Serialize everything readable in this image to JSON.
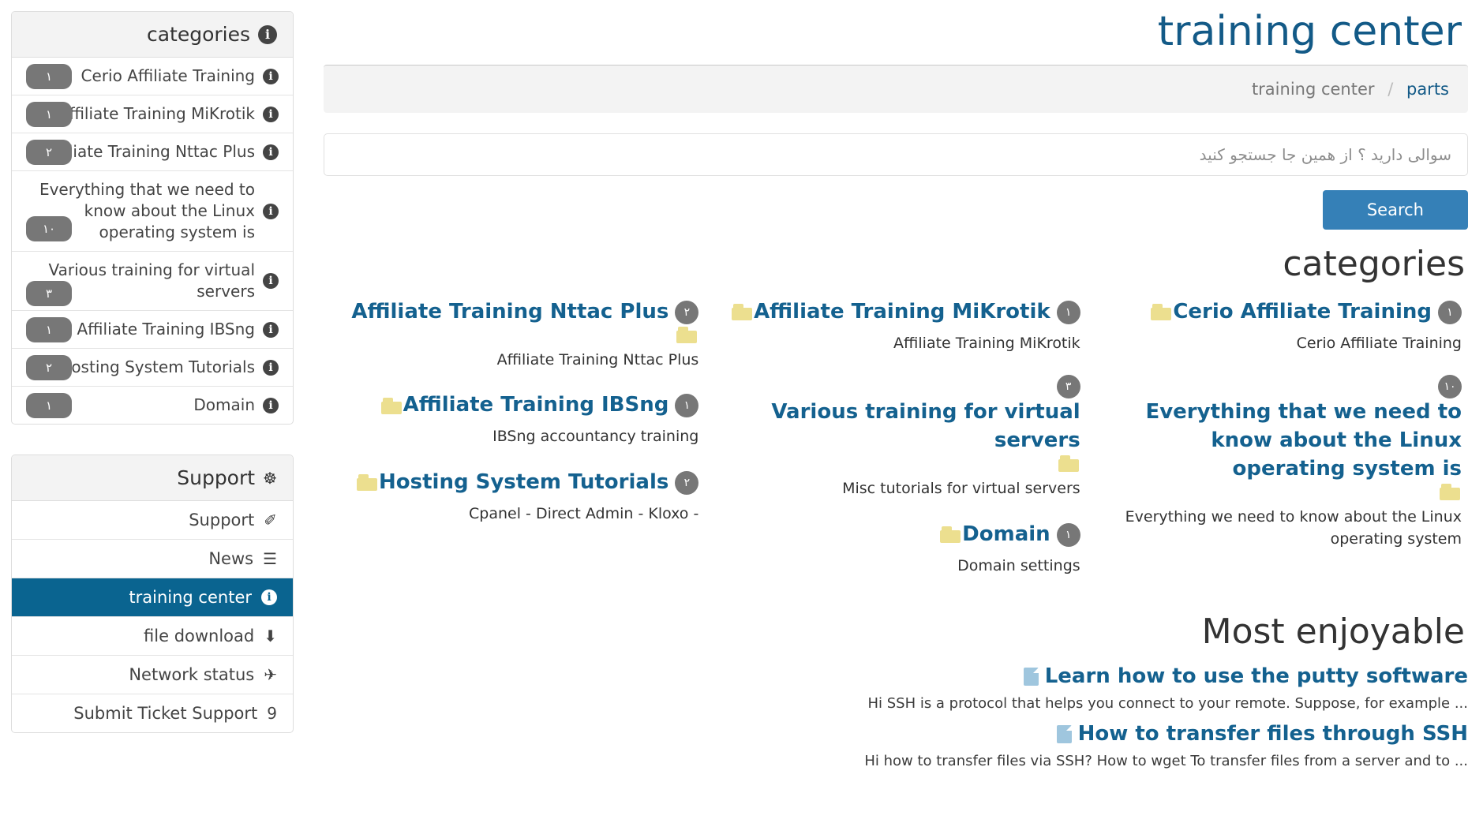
{
  "sidebar": {
    "categories_panel": {
      "title": "categories",
      "title_icon": "info-icon",
      "items": [
        {
          "label": "Cerio Affiliate Training",
          "count": "١",
          "tall": false
        },
        {
          "label": "Affiliate Training MiKrotik",
          "count": "١",
          "tall": false
        },
        {
          "label": "Affiliate Training Nttac Plus",
          "count": "٢",
          "tall": false
        },
        {
          "label": "Everything that we need to know about the Linux operating system is",
          "count": "١٠",
          "tall": true
        },
        {
          "label": "Various training for virtual servers",
          "count": "٣",
          "tall": true
        },
        {
          "label": "Affiliate Training IBSng",
          "count": "١",
          "tall": false
        },
        {
          "label": "Hosting System Tutorials",
          "count": "٢",
          "tall": false
        },
        {
          "label": "Domain",
          "count": "١",
          "tall": false
        }
      ]
    },
    "support_panel": {
      "title": "Support",
      "title_icon": "lifebuoy-icon",
      "items": [
        {
          "label": "Support",
          "icon": "ticket-icon",
          "glyph": "✐",
          "active": false
        },
        {
          "label": "News",
          "icon": "list-icon",
          "glyph": "☰",
          "active": false
        },
        {
          "label": "training center",
          "icon": "info-icon",
          "glyph": "",
          "active": true
        },
        {
          "label": "file download",
          "icon": "download-icon",
          "glyph": "⬇",
          "active": false
        },
        {
          "label": "Network status",
          "icon": "rocket-icon",
          "glyph": "✈",
          "active": false
        },
        {
          "label": "Submit Ticket Support",
          "icon": "comment-icon",
          "glyph": "὞9",
          "active": false
        }
      ]
    }
  },
  "header": {
    "site_title": "training center",
    "breadcrumb": {
      "root": "training center",
      "separator": "/",
      "current": "parts"
    }
  },
  "search": {
    "placeholder": "سوالی دارید ؟ از همین جا جستجو کنید",
    "value": "",
    "button_label": "Search"
  },
  "categories_section": {
    "title": "categories",
    "columns": [
      {
        "items": [
          {
            "title": "Cerio Affiliate Training",
            "count": "١",
            "description": "Cerio Affiliate Training",
            "folder": true
          },
          {
            "title": "Everything that we need to know about the Linux operating system is",
            "count": "١٠",
            "description": "Everything we need to know about the Linux operating system",
            "folder": true
          }
        ]
      },
      {
        "items": [
          {
            "title": "Affiliate Training MiKrotik",
            "count": "١",
            "description": "Affiliate Training MiKrotik",
            "folder": true
          },
          {
            "title": "Various training for virtual servers",
            "count": "٣",
            "description": "Misc tutorials for virtual servers",
            "folder": true
          },
          {
            "title": "Domain",
            "count": "١",
            "description": "Domain settings",
            "folder": true
          }
        ]
      },
      {
        "items": [
          {
            "title": "Affiliate Training Nttac Plus",
            "count": "٢",
            "description": "Affiliate Training Nttac Plus",
            "folder": true
          },
          {
            "title": "Affiliate Training IBSng",
            "count": "١",
            "description": "IBSng accountancy training",
            "folder": true
          },
          {
            "title": "Hosting System Tutorials",
            "count": "٢",
            "description": "- Cpanel - Direct Admin - Kloxo",
            "folder": true
          }
        ]
      }
    ]
  },
  "most_enjoyable": {
    "title": "Most enjoyable",
    "articles": [
      {
        "title": "Learn how to use the putty software",
        "excerpt": "... Hi SSH is a protocol that helps you connect to your remote. Suppose, for example"
      },
      {
        "title": "How to transfer files through SSH",
        "excerpt": "... Hi how to transfer files via SSH? How to wget To transfer files from a server and to"
      }
    ]
  },
  "colors": {
    "accent_blue": "#14618f",
    "active_nav": "#0a6490",
    "button_blue": "#3580b7",
    "badge_gray": "#777777",
    "folder_yellow": "#ecdf8f"
  }
}
